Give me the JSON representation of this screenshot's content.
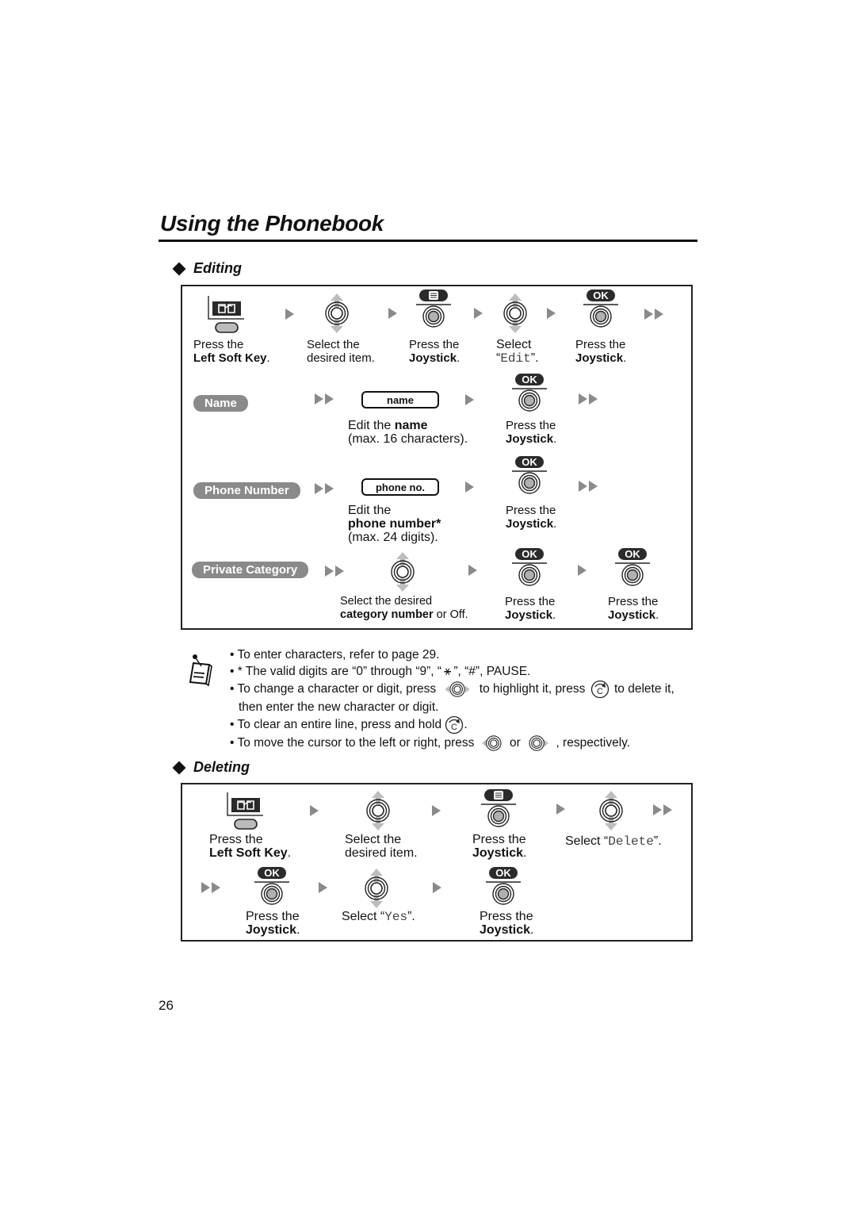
{
  "page": {
    "title": "Using the Phonebook",
    "page_number": "26"
  },
  "editing": {
    "heading": "Editing",
    "steps": [
      {
        "icon": "left-soft-key-icon",
        "line1": "Press the",
        "line2_bold": "Left Soft Key",
        "line2_rest": "."
      },
      {
        "icon": "joystick-up-down-icon",
        "line1": "Select the",
        "line2": "desired item."
      },
      {
        "icon": "joystick-menu-press-icon",
        "key_label": "menu",
        "line1": "Press the",
        "line2_bold": "Joystick",
        "line2_rest": "."
      },
      {
        "icon": "joystick-up-down-icon",
        "line1": "Select",
        "line2_pre": "“",
        "line2_mono": "Edit",
        "line2_post": "”."
      },
      {
        "icon": "joystick-ok-press-icon",
        "key_label": "OK",
        "line1": "Press the",
        "line2_bold": "Joystick",
        "line2_rest": "."
      }
    ],
    "branches": [
      {
        "label": "Name",
        "field": "name",
        "desc_line1_pre": "Edit the ",
        "desc_line1_bold": "name",
        "desc_line2": "(max. 16 characters).",
        "ok_label": "OK",
        "press_line1": "Press the",
        "press_line2_bold": "Joystick",
        "press_line2_rest": "."
      },
      {
        "label": "Phone Number",
        "field": "phone no.",
        "desc_line1": "Edit the",
        "desc_line2_bold": "phone number*",
        "desc_line3": "(max. 24 digits).",
        "ok_label": "OK",
        "press_line1": "Press the",
        "press_line2_bold": "Joystick",
        "press_line2_rest": "."
      },
      {
        "label": "Private Category",
        "desc_line1": "Select the desired",
        "desc_line2_bold": "category number",
        "desc_line2_rest": " or Off.",
        "ok_label": "OK",
        "press_line1": "Press the",
        "press_line2_bold": "Joystick",
        "press_line2_rest": ".",
        "ok2_label": "OK",
        "press2_line1": "Press the",
        "press2_line2_bold": "Joystick",
        "press2_line2_rest": "."
      }
    ]
  },
  "notes": {
    "icon": "note-icon",
    "items": [
      {
        "text": "To enter characters, refer to page 29."
      },
      {
        "pre": "* The valid digits are “0” through “9”, “",
        "symbol": "⚹",
        "post": "”, “#”, PAUSE."
      },
      {
        "pre": "To change a character or digit, press",
        "mid": "to highlight it, press",
        "post": "to delete it,",
        "cont": "then enter the new character or digit."
      },
      {
        "pre": "To clear an entire line, press and hold",
        "post": "."
      },
      {
        "pre": "To move the cursor to the left or right, press",
        "mid": "or",
        "post": ", respectively."
      }
    ]
  },
  "deleting": {
    "heading": "Deleting",
    "steps": [
      {
        "icon": "left-soft-key-icon",
        "line1": "Press the",
        "line2_bold": "Left Soft Key",
        "line2_rest": "."
      },
      {
        "icon": "joystick-up-down-icon",
        "line1": "Select the",
        "line2": "desired item."
      },
      {
        "icon": "joystick-menu-press-icon",
        "key_label": "menu",
        "line1": "Press the",
        "line2_bold": "Joystick",
        "line2_rest": "."
      },
      {
        "icon": "joystick-up-down-icon",
        "line1_pre": "Select “",
        "line1_mono": "Delete",
        "line1_post": "”."
      },
      {
        "icon": "joystick-ok-press-icon",
        "key_label": "OK",
        "line1": "Press the",
        "line2_bold": "Joystick",
        "line2_rest": "."
      },
      {
        "icon": "joystick-up-down-icon",
        "line1_pre": "Select “",
        "line1_mono": "Yes",
        "line1_post": "”."
      },
      {
        "icon": "joystick-ok-press-icon",
        "key_label": "OK",
        "line1": "Press the",
        "line2_bold": "Joystick",
        "line2_rest": "."
      }
    ]
  }
}
